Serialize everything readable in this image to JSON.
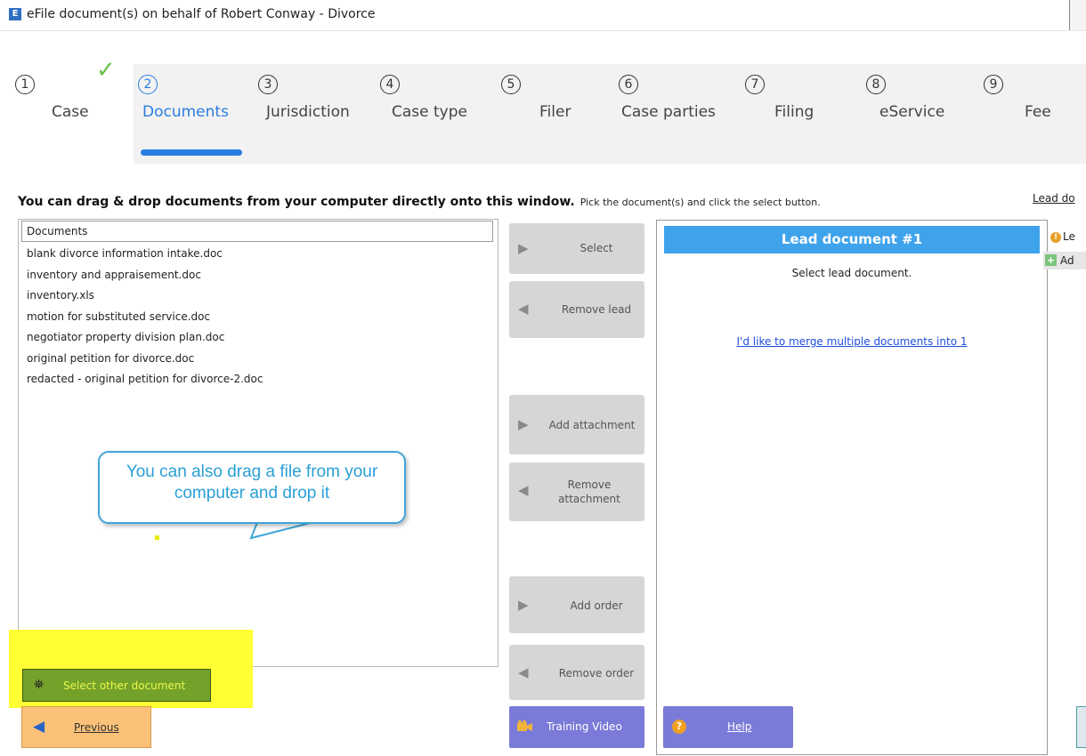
{
  "window": {
    "title": "eFile document(s) on behalf of Robert Conway - Divorce",
    "app_icon": "E"
  },
  "steps": [
    {
      "num": "1",
      "label": "Case",
      "state": "done"
    },
    {
      "num": "2",
      "label": "Documents",
      "state": "active"
    },
    {
      "num": "3",
      "label": "Jurisdiction",
      "state": "pending"
    },
    {
      "num": "4",
      "label": "Case type",
      "state": "pending"
    },
    {
      "num": "5",
      "label": "Filer",
      "state": "pending"
    },
    {
      "num": "6",
      "label": "Case parties",
      "state": "pending"
    },
    {
      "num": "7",
      "label": "Filing",
      "state": "pending"
    },
    {
      "num": "8",
      "label": "eService",
      "state": "pending"
    },
    {
      "num": "9",
      "label": "Fee",
      "state": "pending"
    }
  ],
  "instructions": {
    "main": "You can drag & drop documents from your computer directly onto this window.",
    "sub": "Pick the document(s) and click the select button.",
    "right_link": "Lead do"
  },
  "documents": {
    "header": "Documents",
    "items": [
      "blank divorce information intake.doc",
      "inventory and appraisement.doc",
      "inventory.xls",
      "motion for substituted service.doc",
      "negotiator property division plan.doc",
      "original petition for divorce.doc",
      "redacted  - original petition for divorce-2.doc"
    ]
  },
  "actions": {
    "select": "Select",
    "remove_lead": "Remove lead",
    "add_attachment": "Add attachment",
    "remove_attachment": "Remove attachment",
    "add_order": "Add order",
    "remove_order": "Remove order"
  },
  "lead_panel": {
    "header": "Lead document #1",
    "prompt": "Select lead document.",
    "merge_link": "I'd like to merge multiple documents into 1"
  },
  "side_panel": {
    "item1": "Le",
    "item2": "Ad"
  },
  "tooltip": {
    "text": "You can also drag a file from your computer and drop it"
  },
  "footer": {
    "select_other": "Select other document",
    "previous": "Previous",
    "training_video": "Training Video",
    "help": "Help"
  },
  "colors": {
    "accent": "#2a7de1",
    "lead_header": "#3fa3ec",
    "footer_button": "#7a7ad8",
    "previous_button": "#fbc178",
    "select_other_button": "#74a12a",
    "highlight": "#ffff33",
    "check": "#6cc04a"
  },
  "icons": {
    "check": "check-icon",
    "select": "play-right-icon",
    "remove": "play-left-icon",
    "binoculars": "binoculars-icon",
    "video": "video-camera-icon",
    "help": "question-icon"
  }
}
